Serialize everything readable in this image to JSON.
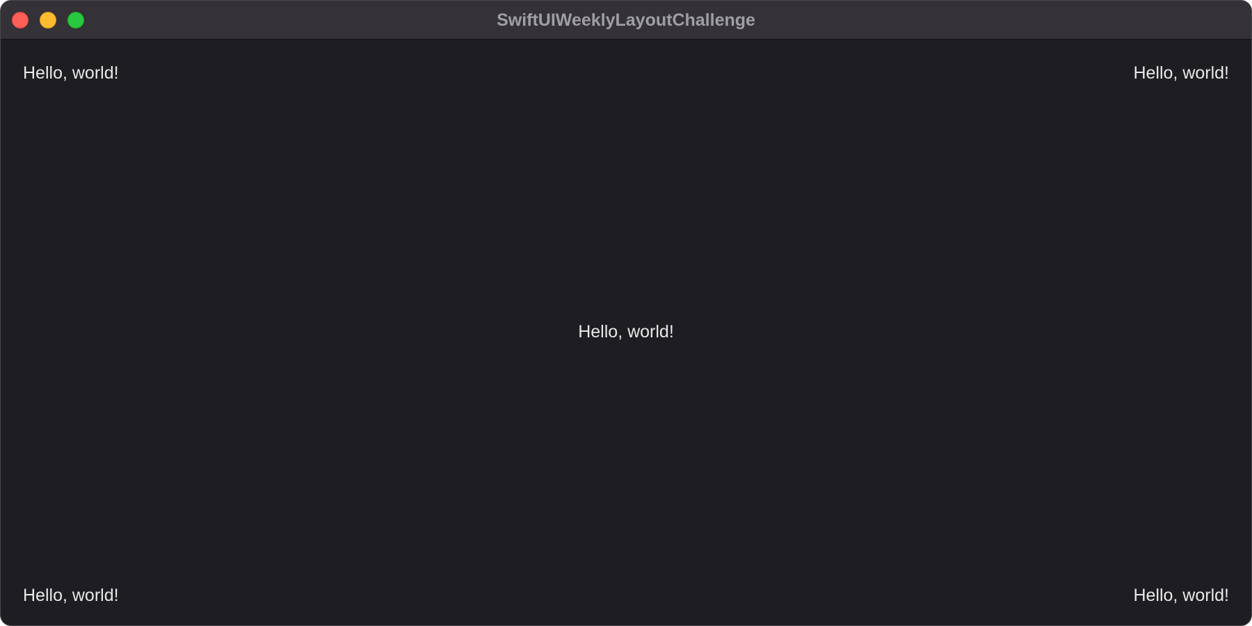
{
  "window": {
    "title": "SwiftUIWeeklyLayoutChallenge",
    "traffic_lights": {
      "close_color": "#fe5f57",
      "minimize_color": "#febc2e",
      "zoom_color": "#28c840"
    }
  },
  "content": {
    "background_color": "#1e1d21",
    "labels": {
      "top_left": "Hello, world!",
      "top_right": "Hello, world!",
      "center": "Hello, world!",
      "bottom_left": "Hello, world!",
      "bottom_right": "Hello, world!"
    }
  }
}
